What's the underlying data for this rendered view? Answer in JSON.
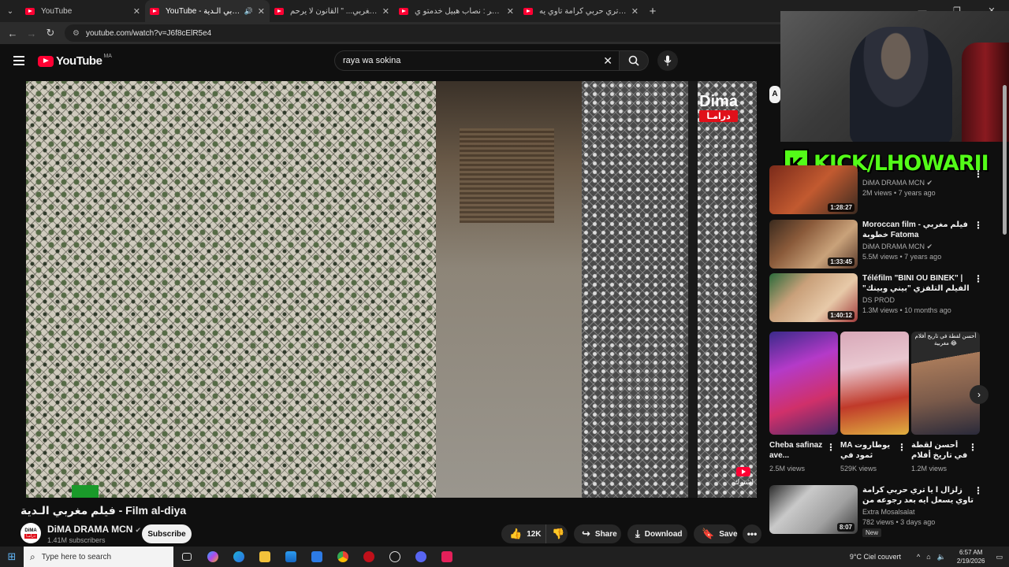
{
  "browser": {
    "tabs": [
      {
        "title": "YouTube",
        "active": false,
        "audio": false
      },
      {
        "title": "YouTube - فيلم مغربي الـدية",
        "active": true,
        "audio": true
      },
      {
        "title": "فيلم مغربي... \" القانون لا يرحم \"",
        "active": false,
        "audio": false
      },
      {
        "title": "فيلم قصير : نصاب هبيل خدمتو ي...",
        "active": false,
        "audio": false
      },
      {
        "title": "زلزال ا يا تري حربي كرامة تاوي يه...",
        "active": false,
        "audio": false
      }
    ],
    "url": "youtube.com/watch?v=J6f8cElR5e4"
  },
  "youtube": {
    "logo_text": "YouTube",
    "country_code": "MA",
    "search_query": "raya wa sokina"
  },
  "video": {
    "title": "فيلم مغربي الـدية - Film al-diya",
    "watermark_top": "Dima",
    "watermark_arabic": "درامـا",
    "subscribe_watermark": "اشترك",
    "channel_name": "DiMA DRAMA MCN",
    "subscribers": "1.41M subscribers",
    "subscribe_label": "Subscribe",
    "likes": "12K",
    "share_label": "Share",
    "download_label": "Download",
    "save_label": "Save",
    "avatar_text": "DiMA",
    "avatar_sub": "درامـا"
  },
  "overlay": {
    "kick_letter": "K",
    "kick_text": "KICK/LHOWARII",
    "chip_letter": "A"
  },
  "recommendations": [
    {
      "title": "",
      "channel": "DiMA DRAMA MCN",
      "meta": "2M views • 7 years ago",
      "duration": "1:28:27",
      "verified": true
    },
    {
      "title": "Moroccan film - فيلم مغربي خطوبة Fatoma",
      "channel": "DiMA DRAMA MCN",
      "meta": "5.5M views • 7 years ago",
      "duration": "1:33:45",
      "verified": true
    },
    {
      "title": "Téléfilm \"BINI OU BINEK\" | الفيلم التلفزي \"بيني وبينك\" من إخراج ادريس ...",
      "channel": "DS PROD",
      "meta": "1.3M views • 10 months ago",
      "duration": "1:40:12",
      "verified": false
    },
    {
      "title": "زلزال ا يا تري حربي كرامة تاوي يسعل ايه بعد رجوعه من الغربه",
      "channel": "Extra Mosalsalat",
      "meta": "782 views • 3 days ago",
      "duration": "8:07",
      "badge": "New",
      "verified": false
    }
  ],
  "shorts": [
    {
      "title": "Cheba safinaz ave...",
      "views": "2.5M views"
    },
    {
      "title": "MA يوطاروت ثمود في رمضان",
      "views": "529K views"
    },
    {
      "title": "أحسن لقطة في تاريخ أفلام ...",
      "views": "1.2M views",
      "caption": "أحسن لقطة في تاريخ أفلام مغربية 😂"
    }
  ],
  "taskbar": {
    "search_placeholder": "Type here to search",
    "weather": "9°C  Ciel couvert",
    "time": "6:57 AM",
    "date": "2/19/2026"
  },
  "colors": {
    "background": "#0f0f0f",
    "youtube_red": "#ff0033",
    "kick_green": "#53fc18"
  }
}
